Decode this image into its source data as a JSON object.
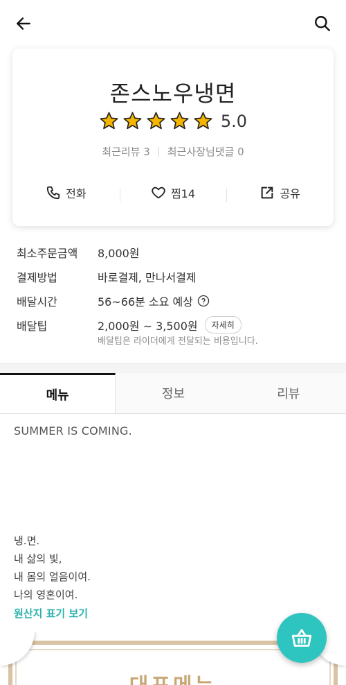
{
  "store": {
    "name": "존스노우냉면",
    "rating": "5.0",
    "stars": 5,
    "recent_reviews": "최근리뷰 3",
    "recent_owner_comments": "최근사장님댓글 0"
  },
  "actions": {
    "call": "전화",
    "favorite": "찜14",
    "share": "공유"
  },
  "info": {
    "min_order_label": "최소주문금액",
    "min_order_value": "8,000원",
    "payment_label": "결제방법",
    "payment_value": "바로결제, 만나서결제",
    "delivery_time_label": "배달시간",
    "delivery_time_value": "56~66분 소요 예상",
    "delivery_tip_label": "배달팁",
    "delivery_tip_value": "2,000원 ~ 3,500원",
    "detail_button": "자세히",
    "tip_note": "배달팁은 라이더에게 전달되는 비용입니다."
  },
  "tabs": {
    "menu": "메뉴",
    "info": "정보",
    "review": "리뷰"
  },
  "content": {
    "headline": "SUMMER IS COMING.",
    "poem_line1": "냉.면.",
    "poem_line2": "내 삶의 빛,",
    "poem_line3": "내 몸의 얼음이여.",
    "poem_line4": "나의 영혼이여.",
    "origin_link": "원산지 표기 보기"
  },
  "banner": {
    "title": "대표메뉴"
  },
  "colors": {
    "accent": "#2ec4bf",
    "link": "#2ab2ad",
    "star": "#f5b400",
    "banner_gold": "#c9a878"
  }
}
